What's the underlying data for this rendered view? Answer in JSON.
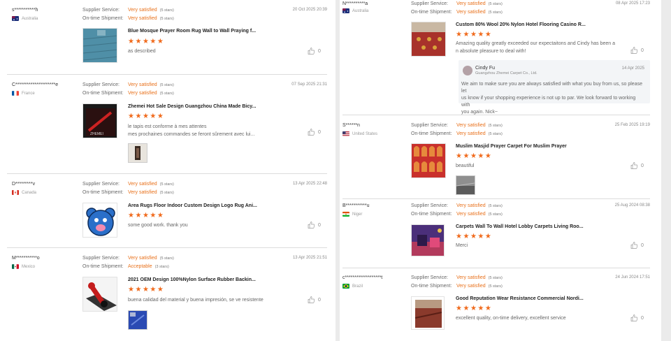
{
  "labels": {
    "supplier_service": "Supplier Service:",
    "on_time_shipment": "On-time Shipment:"
  },
  "colors": {
    "accent": "#e8701a",
    "star": "#f06a1c"
  },
  "left": [
    {
      "user": "s***********h",
      "country": "Australia",
      "flag": "australia-flag",
      "supplier_service": "Very satisfied",
      "supplier_count": "(5 stars)",
      "shipment": "Very satisfied",
      "shipment_count": "(5 stars)",
      "date": "20 Oct 2025 20:39",
      "product": "Blue Mosque Prayer Room Rug Wall to Wall Praying f...",
      "rating": 5,
      "comment": "as described",
      "likes": "0"
    },
    {
      "user": "C*********************e",
      "country": "France",
      "flag": "france-flag",
      "supplier_service": "Very satisfied",
      "supplier_count": "(5 stars)",
      "shipment": "Very satisfied",
      "shipment_count": "(5 stars)",
      "date": "07 Sep 2025 21:31",
      "product": "Zhemei Hot Sale Design Guangzhou China Made Bicy...",
      "rating": 5,
      "comment_line1": "le tapis est conforme à mes attentes",
      "comment_line2": "mes prochaines commandes se feront sûrement avec lui...",
      "likes": "0"
    },
    {
      "user": "D*********v",
      "country": "Canada",
      "flag": "canada-flag",
      "supplier_service": "Very satisfied",
      "supplier_count": "(5 stars)",
      "shipment": "Very satisfied",
      "shipment_count": "(5 stars)",
      "date": "13 Apr 2025 22:48",
      "product": "Area Rugs Floor Indoor Custom Design Logo Rug Ani...",
      "rating": 5,
      "comment": "some good work. thank you",
      "likes": "0"
    },
    {
      "user": "M***********o",
      "country": "Mexico",
      "flag": "mexico-flag",
      "supplier_service": "Very satisfied",
      "supplier_count": "(5 stars)",
      "shipment": "Acceptable",
      "shipment_count": "(3 stars)",
      "date": "13 Apr 2025 21:51",
      "product": "2021 OEM Design 100%Nylon Surface Rubber Backin...",
      "rating": 5,
      "comment": "buena calidad del material y buena impresión, se ve resistente",
      "likes": "0"
    }
  ],
  "right": [
    {
      "user": "N**********a",
      "country": "Australia",
      "flag": "australia-flag",
      "supplier_service": "Very satisfied",
      "supplier_count": "(5 stars)",
      "shipment": "Very satisfied",
      "shipment_count": "(5 stars)",
      "date": "08 Apr 2025 17:23",
      "product": "Custom 80% Wool 20% Nylon Hotel Flooring Casino R...",
      "rating": 5,
      "comment_line1": "Amazing quality greatly exceeded our expectaitons and Cindy has been a",
      "comment_line2": "n absolute pleasure to deal with!",
      "likes": "0",
      "reply": {
        "name": "Cindy Fu",
        "company": "Guangzhou Zhemei Carpet Co., Ltd.",
        "date": "14 Apr 2025",
        "line1": "We aim to make sure you are always satisfied with what you buy from us, so please let",
        "line2": "us know if your shopping experience is not up to par. We look forward to working with",
        "line3": "you again. Nick~"
      }
    },
    {
      "user": "S******n",
      "country": "United States",
      "flag": "usa-flag",
      "supplier_service": "Very satisfied",
      "supplier_count": "(5 stars)",
      "shipment": "Very satisfied",
      "shipment_count": "(5 stars)",
      "date": "25 Feb 2025 19:19",
      "product": "Muslim Masjid Prayer Carpet For Muslim Prayer",
      "rating": 5,
      "comment": "beautiful",
      "likes": "0"
    },
    {
      "user": "B***********u",
      "country": "Niger",
      "flag": "niger-flag",
      "supplier_service": "Very satisfied",
      "supplier_count": "(5 stars)",
      "shipment": "Very satisfied",
      "shipment_count": "(5 stars)",
      "date": "25 Aug 2024 08:38",
      "product": "Carpets Wall To Wall Hotel Lobby Carpets Living Roo...",
      "rating": 5,
      "comment": "Merci",
      "likes": "0"
    },
    {
      "user": "c*******************t",
      "country": "Brazil",
      "flag": "brazil-flag",
      "supplier_service": "Very satisfied",
      "supplier_count": "(5 stars)",
      "shipment": "Very satisfied",
      "shipment_count": "(5 stars)",
      "date": "24 Jun 2024 17:51",
      "product": "Good Reputation Wear Resistance Commercial Nordi...",
      "rating": 5,
      "comment": "excellent quality, on-time delivery, excellent service",
      "likes": "0"
    }
  ]
}
